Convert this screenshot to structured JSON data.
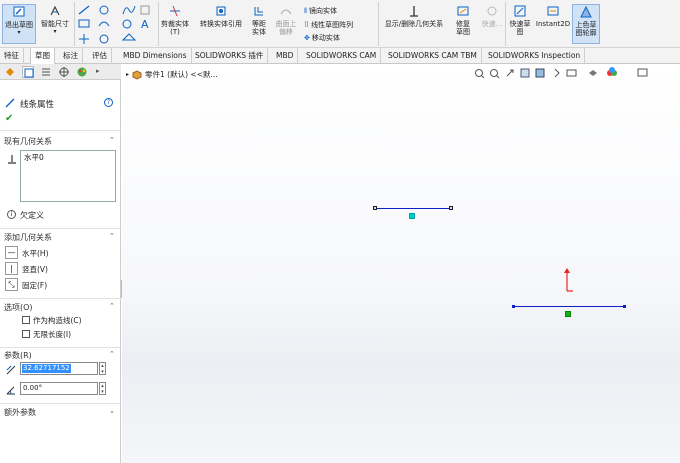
{
  "ribbon": {
    "exit_sketch": "退出草图",
    "smart_dimension": "智能尺寸",
    "trim_entities": "剪裁实体(T)",
    "convert_entities": "转换实体引用",
    "offset_entities": "等距实体",
    "offset_on_surface": "曲面上偏移",
    "mirror_entities": "镜向实体",
    "linear_pattern": "线性草图阵列",
    "move_entities": "移动实体",
    "display_relations": "显示/删除几何关系",
    "repair_sketch": "修复草图",
    "quick_snaps": "快速...",
    "rapid_sketch": "快速草图",
    "instant2d": "Instant2D",
    "shaded_contours": "上色草图轮廓"
  },
  "tabs": [
    "特征",
    "草图",
    "标注",
    "评估",
    "MBD Dimensions",
    "SOLIDWORKS 插件",
    "MBD",
    "SOLIDWORKS CAM",
    "SOLIDWORKS CAM TBM",
    "SOLIDWORKS Inspection"
  ],
  "panel": {
    "title": "线条属性",
    "existing_relations": {
      "header": "现有几何关系",
      "items": [
        "水平0"
      ],
      "status": "欠定义"
    },
    "add_relations": {
      "header": "添加几何关系",
      "items": [
        "水平(H)",
        "竖直(V)",
        "固定(F)"
      ]
    },
    "options": {
      "header": "选项(O)",
      "items": [
        "作为构造线(C)",
        "无限长度(I)"
      ]
    },
    "parameters": {
      "header": "参数(R)",
      "length": "32.62717152",
      "angle": "0.00°"
    },
    "extra": "额外参数"
  },
  "tree": {
    "label": "零件1 (默认) <<默..."
  },
  "colors": {
    "accent": "#0b62c4",
    "line_blue": "#1020c8",
    "selected": "#3390ff"
  }
}
